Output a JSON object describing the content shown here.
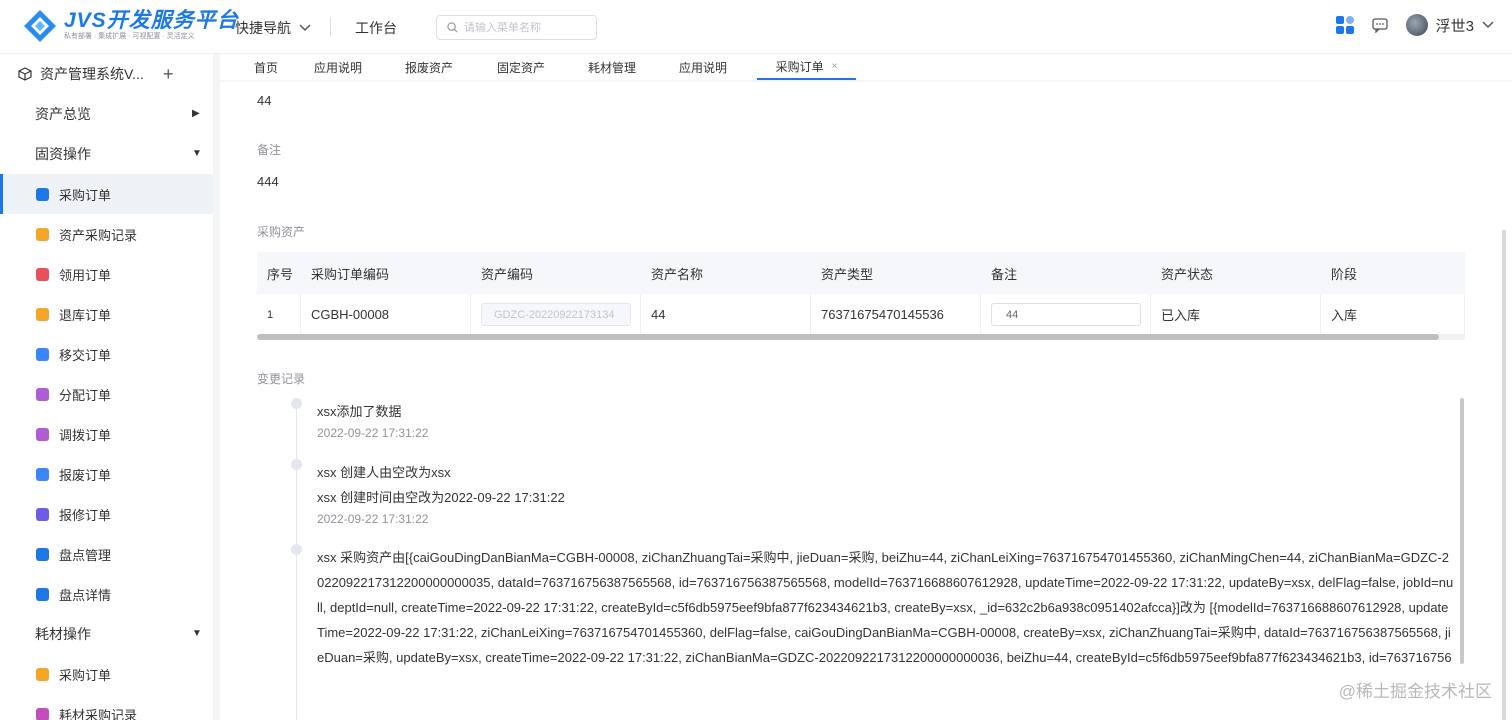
{
  "header": {
    "logo_title": "JVS开发服务平台",
    "logo_sub": "私有部署 · 集成扩展 · 可视配置 · 灵活定义",
    "quick_nav": "快捷导航",
    "workbench": "工作台",
    "search_placeholder": "请输入菜单名称",
    "username": "浮世3"
  },
  "sidebar": {
    "app_title": "资产管理系统V...",
    "items": [
      {
        "type": "group",
        "label": "资产总览",
        "arrow": "▶"
      },
      {
        "type": "group",
        "label": "固资操作",
        "arrow": "▼"
      },
      {
        "type": "item",
        "label": "采购订单",
        "icon": "compass-icon",
        "color": "#1b78e6",
        "active": true
      },
      {
        "type": "item",
        "label": "资产采购记录",
        "icon": "cart-icon",
        "color": "#f5a623"
      },
      {
        "type": "item",
        "label": "领用订单",
        "icon": "user-icon",
        "color": "#e8505b"
      },
      {
        "type": "item",
        "label": "退库订单",
        "icon": "cart-icon",
        "color": "#f5a623"
      },
      {
        "type": "item",
        "label": "移交订单",
        "icon": "send-icon",
        "color": "#3a86ff"
      },
      {
        "type": "item",
        "label": "分配订单",
        "icon": "user-icon",
        "color": "#b15cd6"
      },
      {
        "type": "item",
        "label": "调拨订单",
        "icon": "user-icon",
        "color": "#b15cd6"
      },
      {
        "type": "item",
        "label": "报废订单",
        "icon": "star-icon",
        "color": "#3a86ff"
      },
      {
        "type": "item",
        "label": "报修订单",
        "icon": "wrench-icon",
        "color": "#6c5ce7"
      },
      {
        "type": "item",
        "label": "盘点管理",
        "icon": "box-icon",
        "color": "#1b78e6"
      },
      {
        "type": "item",
        "label": "盘点详情",
        "icon": "book-icon",
        "color": "#1b78e6"
      },
      {
        "type": "group",
        "label": "耗材操作",
        "arrow": "▼"
      },
      {
        "type": "item",
        "label": "采购订单",
        "icon": "cart-icon",
        "color": "#f5a623"
      },
      {
        "type": "item",
        "label": "耗材采购记录",
        "icon": "clock-icon",
        "color": "#c44dbd"
      }
    ]
  },
  "tabs": [
    {
      "label": "首页"
    },
    {
      "label": "应用说明"
    },
    {
      "label": "报废资产"
    },
    {
      "label": "固定资产"
    },
    {
      "label": "耗材管理"
    },
    {
      "label": "应用说明"
    },
    {
      "label": "采购订单",
      "active": true,
      "close": "×"
    }
  ],
  "form": {
    "top_value": "44",
    "remark_label": "备注",
    "remark_value": "444",
    "assets_label": "采购资产",
    "changes_label": "变更记录"
  },
  "table": {
    "headers": [
      "序号",
      "采购订单编码",
      "资产编码",
      "资产名称",
      "资产类型",
      "备注",
      "资产状态",
      "阶段"
    ],
    "row": {
      "index": "1",
      "order_code": "CGBH-00008",
      "asset_code": "GDZC-20220922173134",
      "asset_name": "44",
      "asset_type": "76371675470145536",
      "remark": "44",
      "status": "已入库",
      "stage": "入库"
    }
  },
  "timeline": [
    {
      "lines": [
        "xsx添加了数据"
      ],
      "time": "2022-09-22 17:31:22"
    },
    {
      "lines": [
        "xsx 创建人由空改为xsx",
        "xsx 创建时间由空改为2022-09-22 17:31:22"
      ],
      "time": "2022-09-22 17:31:22"
    },
    {
      "text": "xsx 采购资产由[{caiGouDingDanBianMa=CGBH-00008, ziChanZhuangTai=采购中, jieDuan=采购, beiZhu=44, ziChanLeiXing=763716754701455360, ziChanMingChen=44, ziChanBianMa=GDZC-2022092217312200000000035, dataId=763716756387565568, id=763716756387565568, modelId=763716688607612928, updateTime=2022-09-22 17:31:22, updateBy=xsx, delFlag=false, jobId=null, deptId=null, createTime=2022-09-22 17:31:22, createById=c5f6db5975eef9bfa877f623434621b3, createBy=xsx, _id=632c2b6a938c0951402afcca}]改为 [{modelId=763716688607612928, updateTime=2022-09-22 17:31:22, ziChanLeiXing=763716754701455360, delFlag=false, caiGouDingDanBianMa=CGBH-00008, createBy=xsx, ziChanZhuangTai=采购中, dataId=763716756387565568, jieDuan=采购, updateBy=xsx, createTime=2022-09-22 17:31:22, ziChanBianMa=GDZC-2022092217312200000000036, beiZhu=44, createById=c5f6db5975eef9bfa877f623434621b3, id=763716756"
    }
  ],
  "watermark": "@稀土掘金技术社区"
}
